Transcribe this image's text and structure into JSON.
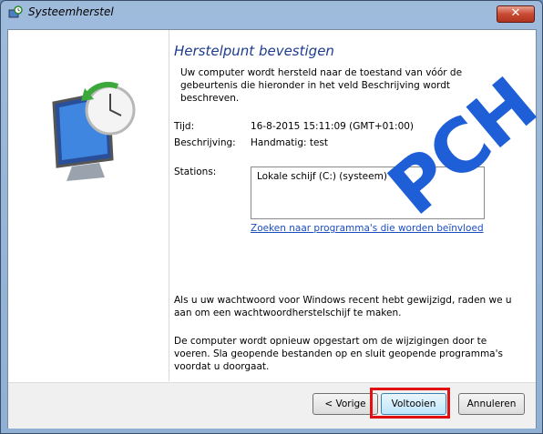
{
  "window": {
    "title": "Systeemherstel",
    "close_glyph": "✕"
  },
  "page": {
    "heading": "Herstelpunt bevestigen",
    "description": "Uw computer wordt hersteld naar de toestand van vóór de gebeurtenis die hieronder in het veld Beschrijving wordt beschreven.",
    "fields": {
      "time_label": "Tijd:",
      "time_value": "16-8-2015 15:11:09 (GMT+01:00)",
      "description_label": "Beschrijving:",
      "description_value": "Handmatig: test",
      "stations_label": "Stations:",
      "stations_items": [
        "Lokale schijf (C:) (systeem)"
      ]
    },
    "link": "Zoeken naar programma's die worden beïnvloed",
    "note1": "Als u uw wachtwoord voor Windows recent hebt gewijzigd, raden we u aan om een wachtwoordherstelschijf te maken.",
    "note2": "De computer wordt opnieuw opgestart om de wijzigingen door te voeren. Sla geopende bestanden op en sluit geopende programma's voordat u doorgaat."
  },
  "buttons": {
    "prev": "< Vorige",
    "finish": "Voltooien",
    "cancel": "Annuleren"
  },
  "watermark": "PCH",
  "colors": {
    "heading": "#1e3c8c",
    "link": "#1b4dbf",
    "highlight": "#e01010",
    "watermark": "#1e5fd8"
  }
}
